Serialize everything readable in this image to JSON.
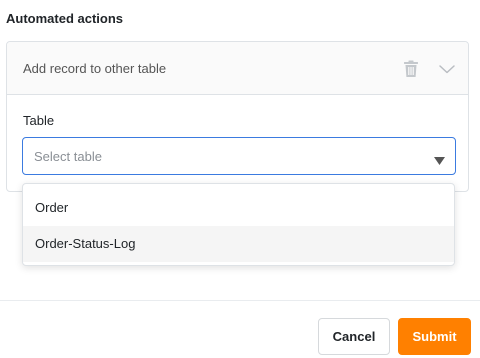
{
  "section": {
    "title": "Automated actions"
  },
  "action_card": {
    "title": "Add record to other table",
    "icons": {
      "delete": "trash-icon",
      "expand": "chevron-down-icon"
    }
  },
  "table_field": {
    "label": "Table",
    "placeholder": "Select table",
    "caret_icon": "caret-down-icon"
  },
  "dropdown": {
    "options": [
      "Order",
      "Order-Status-Log"
    ],
    "hovered_index": 1
  },
  "footer": {
    "cancel_label": "Cancel",
    "submit_label": "Submit"
  },
  "colors": {
    "accent_orange": "#ff8000",
    "focus_blue": "#3b7be0",
    "border": "#dee2e6"
  }
}
